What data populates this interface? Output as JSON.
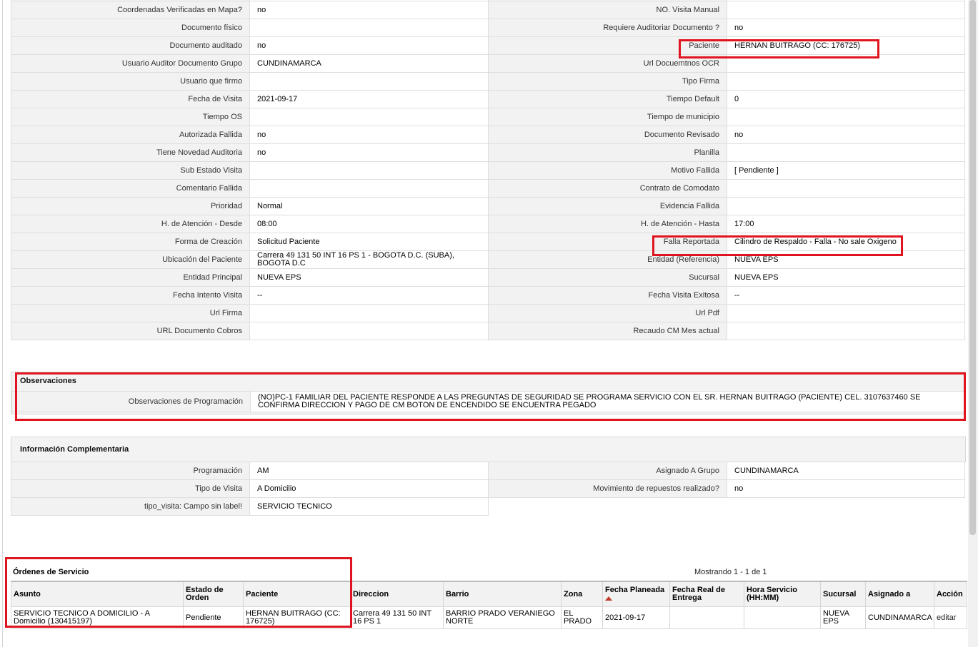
{
  "detail_rows": [
    {
      "l1": "Coordenadas Verificadas en Mapa?",
      "v1": "no",
      "l2": "NO. Visita Manual",
      "v2": ""
    },
    {
      "l1": "Documento físico",
      "v1": "",
      "l2": "Requiere Auditoriar Documento ?",
      "v2": "no"
    },
    {
      "l1": "Documento auditado",
      "v1": "no",
      "l2": "Paciente",
      "v2": "HERNAN BUITRAGO (CC: 176725)"
    },
    {
      "l1": "Usuario Auditor Documento Grupo",
      "v1": "CUNDINAMARCA",
      "l2": "Url Docuemtnos OCR",
      "v2": ""
    },
    {
      "l1": "Usuario que firmo",
      "v1": "",
      "l2": "Tipo Firma",
      "v2": ""
    },
    {
      "l1": "Fecha de Visita",
      "v1": "2021-09-17",
      "l2": "Tiempo Default",
      "v2": "0"
    },
    {
      "l1": "Tiempo OS",
      "v1": "",
      "l2": "Tiempo de municipio",
      "v2": ""
    },
    {
      "l1": "Autorizada Fallida",
      "v1": "no",
      "l2": "Documento Revisado",
      "v2": "no"
    },
    {
      "l1": "Tiene Novedad Auditoria",
      "v1": "no",
      "l2": "Planilla",
      "v2": ""
    },
    {
      "l1": "Sub Estado Visita",
      "v1": "",
      "l2": "Motivo Fallida",
      "v2": "[ Pendiente ]"
    },
    {
      "l1": "Comentario Fallida",
      "v1": "",
      "l2": "Contrato de Comodato",
      "v2": ""
    },
    {
      "l1": "Prioridad",
      "v1": "Normal",
      "l2": "Evidencia Fallida",
      "v2": ""
    },
    {
      "l1": "H. de Atención - Desde",
      "v1": "08:00",
      "l2": "H. de Atención - Hasta",
      "v2": "17:00"
    },
    {
      "l1": "Forma de Creación",
      "v1": "Solicitud Paciente",
      "l2": "Falla Reportada",
      "v2": "Cilindro de Respaldo - Falla - No sale Oxigeno"
    },
    {
      "l1": "Ubicación del Paciente",
      "v1": "Carrera 49 131 50 INT 16 PS 1 - BOGOTA D.C. (SUBA), BOGOTA D.C",
      "l2": "Entidad (Referencia)",
      "v2": "NUEVA EPS"
    },
    {
      "l1": "Entidad Principal",
      "v1": "NUEVA EPS",
      "l2": "Sucursal",
      "v2": "NUEVA EPS"
    },
    {
      "l1": "Fecha Intento Visita",
      "v1": "--",
      "l2": "Fecha Visita Exitosa",
      "v2": "--"
    },
    {
      "l1": "Url Firma",
      "v1": "",
      "l2": "Url Pdf",
      "v2": ""
    },
    {
      "l1": "URL Documento Cobros",
      "v1": "",
      "l2": "Recaudo CM Mes actual",
      "v2": ""
    }
  ],
  "observaciones": {
    "title": "Observaciones",
    "label": "Observaciones de Programación",
    "value": "(NO)PC-1 FAMILIAR DEL PACIENTE RESPONDE A LAS PREGUNTAS DE SEGURIDAD SE PROGRAMA SERVICIO CON EL SR. HERNAN BUITRAGO (PACIENTE) CEL. 3107637460 SE CONFIRMA DIRECCION Y PAGO DE CM BOTON DE ENCENDIDO SE ENCUENTRA PEGADO"
  },
  "complementaria": {
    "title": "Información Complementaria",
    "rows": [
      {
        "l1": "Programación",
        "v1": "AM",
        "l2": "Asignado A Grupo",
        "v2": "CUNDINAMARCA"
      },
      {
        "l1": "Tipo de Visita",
        "v1": "A Domicilio",
        "l2": "Movimiento de repuestos realizado?",
        "v2": "no"
      },
      {
        "l1": "tipo_visita: Campo sin label!",
        "v1": "SERVICIO TECNICO"
      }
    ]
  },
  "ordenes": {
    "title": "Órdenes de Servicio",
    "count": "Mostrando 1 - 1 de 1",
    "headers": [
      "Asunto",
      "Estado de Orden",
      "Paciente",
      "Direccion",
      "Barrio",
      "Zona",
      "Fecha Planeada",
      "Fecha Real de Entrega",
      "Hora Servicio (HH:MM)",
      "Sucursal",
      "Asignado a",
      "Acción"
    ],
    "rows": [
      [
        "SERVICIO TECNICO A DOMICILIO - A Domicilio (130415197)",
        "Pendiente",
        "HERNAN BUITRAGO (CC: 176725)",
        "Carrera 49 131 50 INT 16 PS 1",
        "BARRIO PRADO VERANIEGO NORTE",
        "EL PRADO",
        "2021-09-17",
        "",
        "",
        "NUEVA EPS",
        "CUNDINAMARCA",
        "editar"
      ]
    ]
  },
  "colors": {
    "highlight": "#e0141e",
    "label_bg": "#f2f2f2",
    "border": "#dedede"
  }
}
